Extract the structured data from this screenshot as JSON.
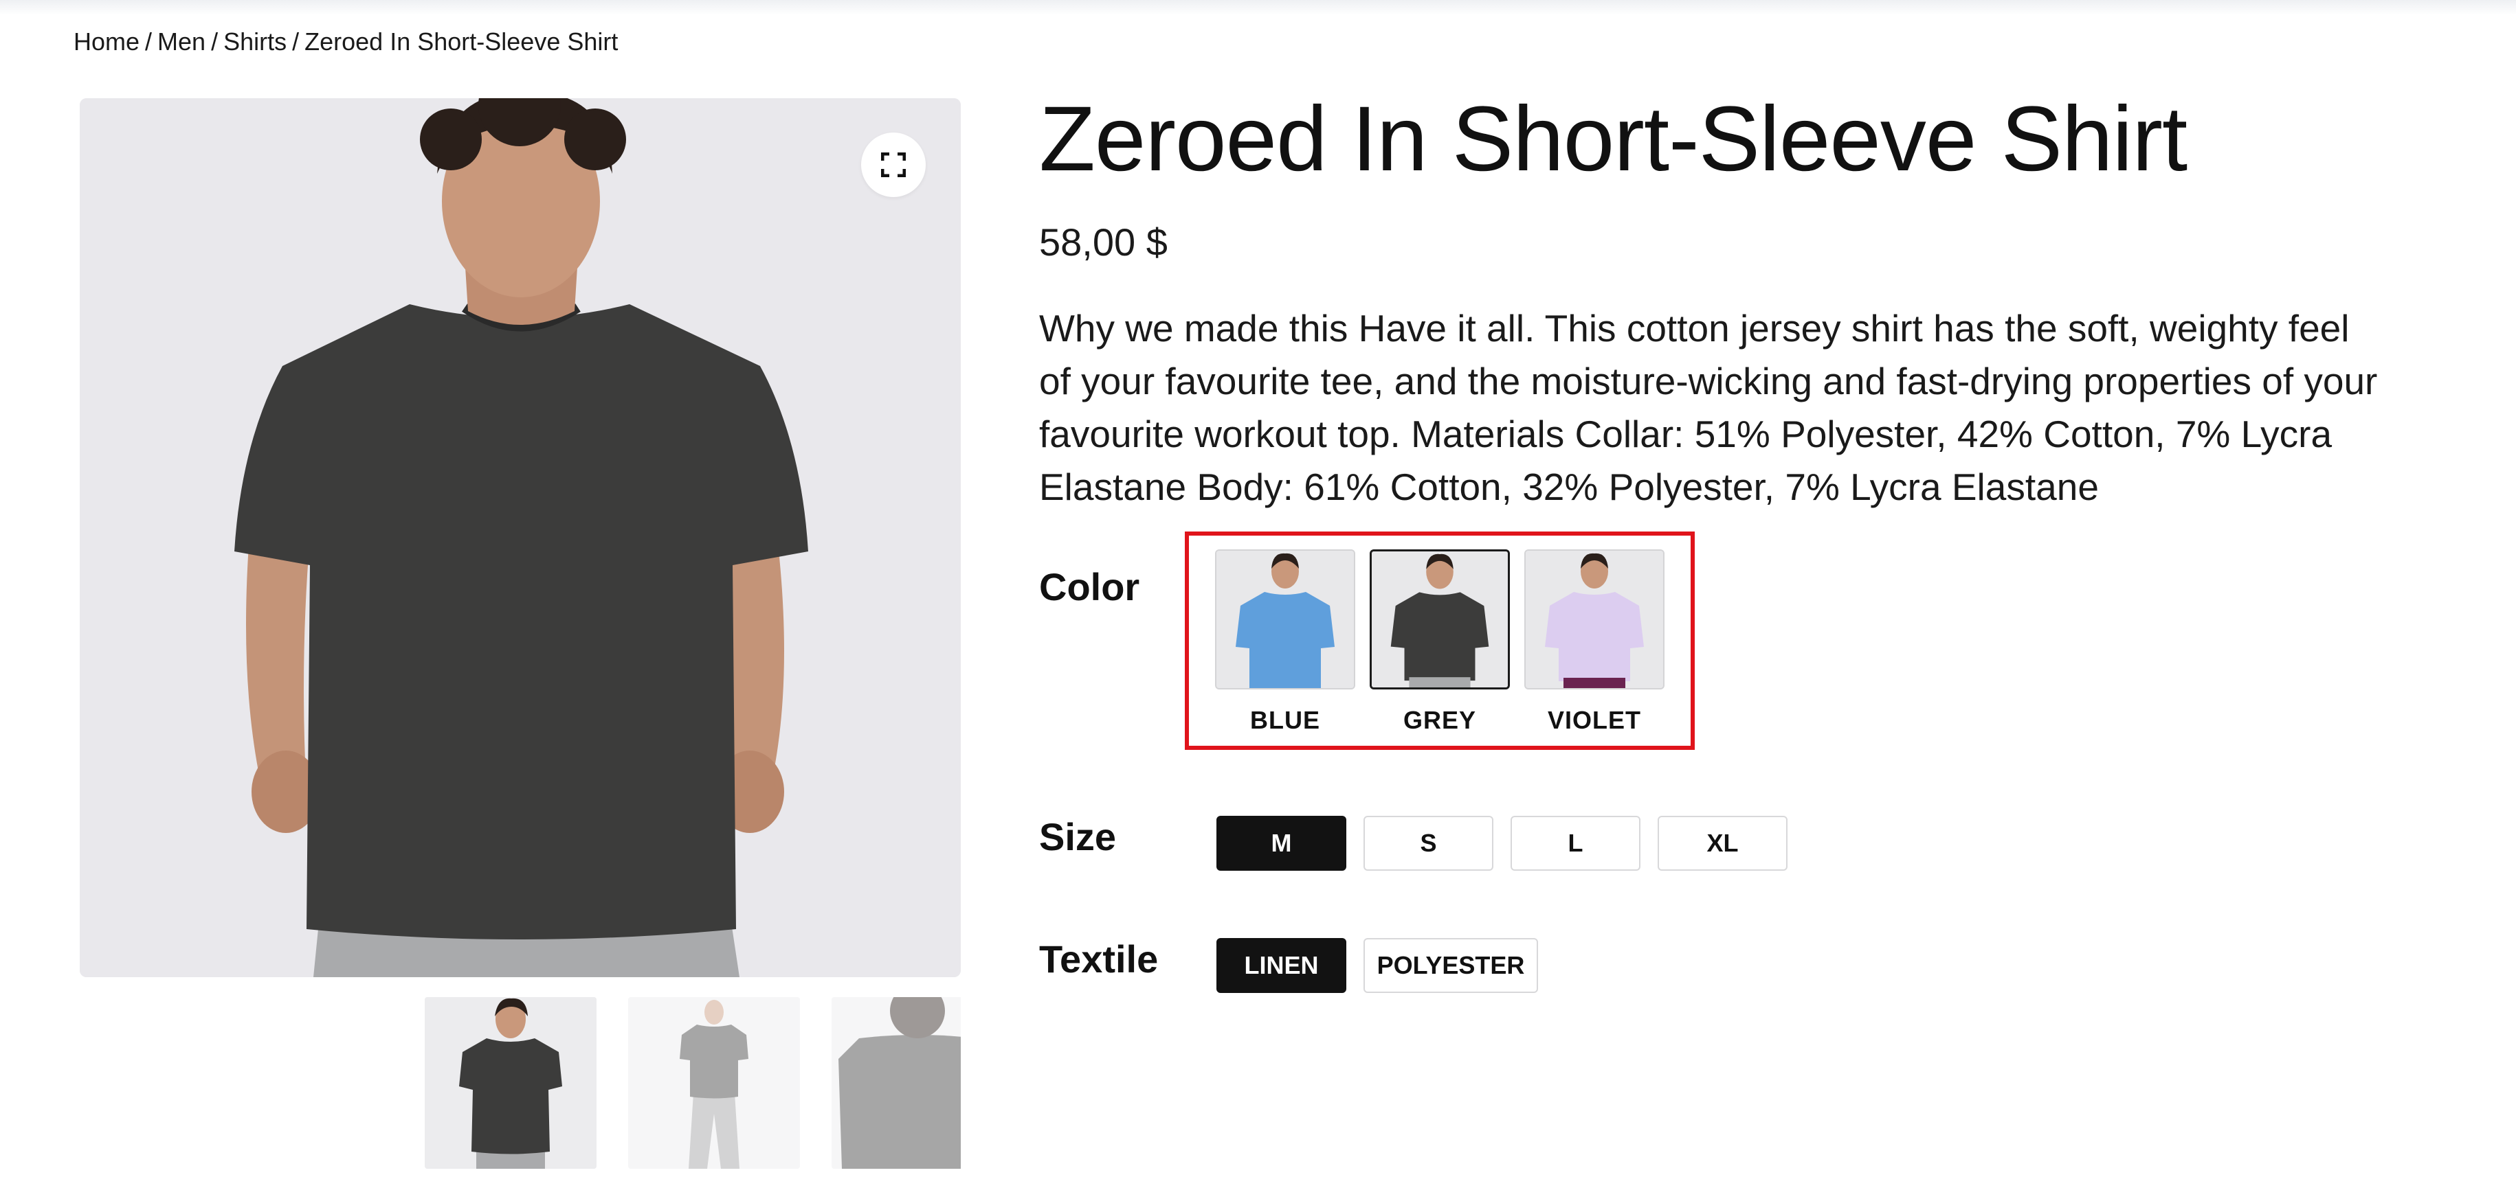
{
  "breadcrumb": {
    "home": "Home",
    "men": "Men",
    "shirts": "Shirts",
    "current": "Zeroed In Short-Sleeve Shirt",
    "separator": "/"
  },
  "product": {
    "title": "Zeroed In Short-Sleeve Shirt",
    "price": "58,00 $",
    "description": "Why we made this Have it all. This cotton jersey shirt has the soft, weighty feel of your favourite tee, and the moisture-wicking and fast-drying properties of your favourite workout top. Materials Collar: 51% Polyester, 42% Cotton, 7% Lycra Elastane Body: 61% Cotton, 32% Polyester, 7% Lycra Elastane"
  },
  "gallery": {
    "expand_icon": "expand-icon",
    "thumbnail_count": 3
  },
  "options": {
    "color": {
      "label": "Color",
      "swatches": [
        {
          "name": "BLUE",
          "shirt_color": "#5f9fdc"
        },
        {
          "name": "GREY",
          "shirt_color": "#3c3c3b"
        },
        {
          "name": "VIOLET",
          "shirt_color": "#dccdf0"
        }
      ],
      "selected": "GREY"
    },
    "size": {
      "label": "Size",
      "values": [
        "M",
        "S",
        "L",
        "XL"
      ],
      "selected": "M"
    },
    "textile": {
      "label": "Textile",
      "values": [
        "LINEN",
        "POLYESTER"
      ],
      "selected": "LINEN"
    }
  },
  "colors": {
    "highlight": "#e0141b",
    "selected_option_bg": "#121212",
    "image_bg": "#e9e8ec"
  }
}
